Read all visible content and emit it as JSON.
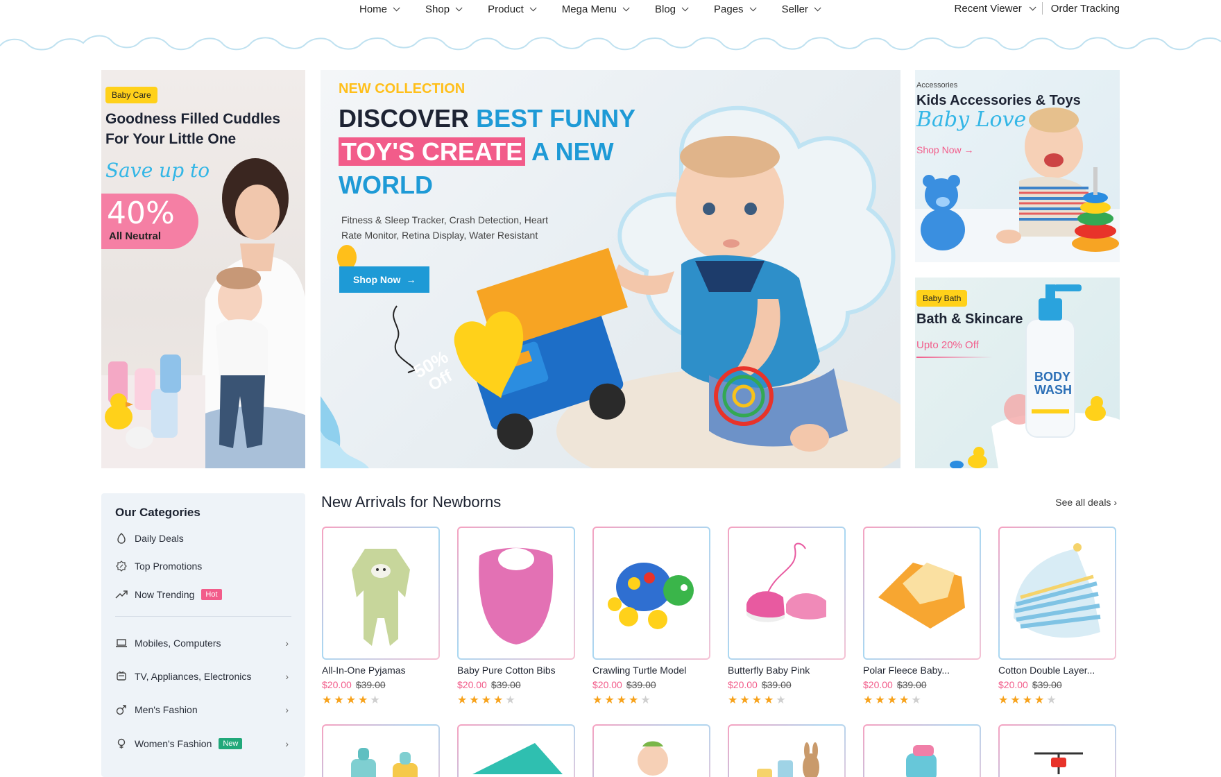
{
  "nav": {
    "items": [
      "Home",
      "Shop",
      "Product",
      "Mega Menu",
      "Blog",
      "Pages",
      "Seller"
    ],
    "recent_viewer": "Recent Viewer",
    "order_tracking": "Order Tracking"
  },
  "banner_left": {
    "tag": "Baby Care",
    "title_line1": "Goodness Filled Cuddles",
    "title_line2": "For Your Little One",
    "script": "Save up to",
    "percent": "40%",
    "sub": "All Neutral"
  },
  "banner_main": {
    "eyebrow": "NEW COLLECTION",
    "line1_dark": "DISCOVER",
    "line1_blue": "BEST FUNNY",
    "line2_pink": "TOY'S CREATE",
    "line2_blue": "A NEW",
    "line3_blue": "WORLD",
    "desc_line1": "Fitness & Sleep Tracker, Crash Detection, Heart",
    "desc_line2": "Rate Monitor, Retina Display, Water Resistant",
    "button": "Shop Now",
    "heart_line1": "50%",
    "heart_line2": "Off"
  },
  "banner_acc": {
    "eyebrow": "Accessories",
    "title": "Kids Accessories & Toys",
    "script": "Baby Love",
    "link": "Shop Now"
  },
  "banner_bath": {
    "tag": "Baby Bath",
    "title": "Bath & Skincare",
    "offer": "Upto 20% Off",
    "bottle_line1": "BODY",
    "bottle_line2": "WASH"
  },
  "sidebar": {
    "title": "Our Categories",
    "top_items": [
      {
        "label": "Daily Deals",
        "icon": "tag-icon"
      },
      {
        "label": "Top Promotions",
        "icon": "promotion-icon"
      },
      {
        "label": "Now Trending",
        "icon": "trending-icon",
        "badge": "Hot"
      }
    ],
    "categories": [
      {
        "label": "Mobiles, Computers",
        "icon": "laptop-icon"
      },
      {
        "label": "TV, Appliances, Electronics",
        "icon": "tv-icon"
      },
      {
        "label": "Men's Fashion",
        "icon": "male-icon"
      },
      {
        "label": "Women's Fashion",
        "icon": "female-icon",
        "badge": "New"
      }
    ]
  },
  "arrivals": {
    "title": "New Arrivals for Newborns",
    "see_all": "See all deals",
    "products": [
      {
        "name": "All-In-One Pyjamas",
        "price": "$20.00",
        "old_price": "$39.00",
        "rating": 4
      },
      {
        "name": "Baby Pure Cotton Bibs",
        "price": "$20.00",
        "old_price": "$39.00",
        "rating": 4
      },
      {
        "name": "Crawling Turtle Model",
        "price": "$20.00",
        "old_price": "$39.00",
        "rating": 4
      },
      {
        "name": "Butterfly Baby Pink",
        "price": "$20.00",
        "old_price": "$39.00",
        "rating": 4
      },
      {
        "name": "Polar Fleece Baby...",
        "price": "$20.00",
        "old_price": "$39.00",
        "rating": 4
      },
      {
        "name": "Cotton Double Layer...",
        "price": "$20.00",
        "old_price": "$39.00",
        "rating": 4
      }
    ]
  },
  "colors": {
    "accent_blue": "#1e9ad6",
    "pink": "#f25c8a",
    "yellow": "#ffd11a",
    "star": "#f7a21b"
  }
}
